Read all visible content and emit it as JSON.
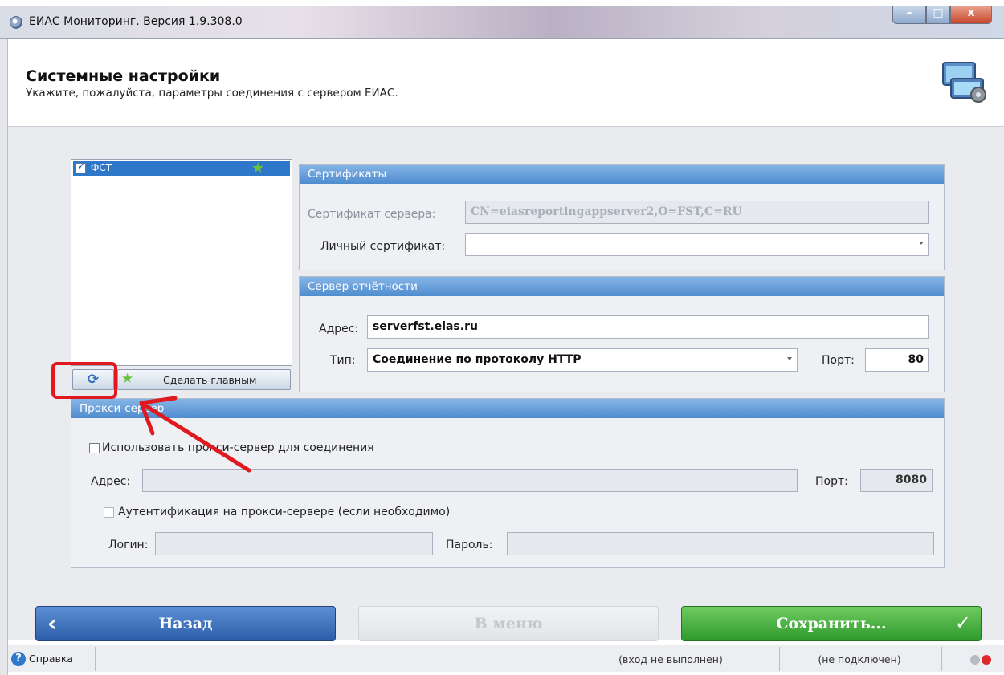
{
  "window": {
    "title": "ЕИАС Мониторинг. Версия 1.9.308.0",
    "minimize_glyph": "–",
    "maximize_glyph": "□",
    "close_glyph": "x"
  },
  "header": {
    "title": "Системные настройки",
    "subtitle": "Укажите, пожалуйста, параметры соединения с сервером ЕИАС."
  },
  "server_list": {
    "items": [
      {
        "label": "ФСТ",
        "checked": true,
        "is_main": true
      }
    ],
    "refresh_icon": "refresh-icon",
    "make_main_label": "Сделать главным"
  },
  "certificates": {
    "heading": "Сертификаты",
    "server_cert_label": "Сертификат сервера:",
    "server_cert_value": "CN=eiasreportingappserver2,O=FST,C=RU",
    "personal_cert_label": "Личный сертификат:",
    "personal_cert_value": ""
  },
  "reporting_server": {
    "heading": "Сервер отчётности",
    "address_label": "Адрес:",
    "address_value": "serverfst.eias.ru",
    "type_label": "Тип:",
    "type_value": "Соединение по протоколу HTTP",
    "port_label": "Порт:",
    "port_value": "80"
  },
  "proxy": {
    "heading": "Прокси-сервер",
    "use_proxy_label": "Использовать прокси-сервер для соединения",
    "use_proxy_checked": false,
    "address_label": "Адрес:",
    "address_value": "",
    "port_label": "Порт:",
    "port_value": "8080",
    "auth_label": "Аутентификация на прокси-сервере (если необходимо)",
    "auth_checked": false,
    "login_label": "Логин:",
    "login_value": "",
    "password_label": "Пароль:",
    "password_value": ""
  },
  "buttons": {
    "back": "Назад",
    "menu": "В меню",
    "save": "Сохранить..."
  },
  "statusbar": {
    "help_label": "Справка",
    "login_status": "(вход не выполнен)",
    "connection_status": "(не подключен)"
  },
  "colors": {
    "accent_blue": "#4f8ccf",
    "save_green": "#2f9a2e",
    "annotation_red": "#e0191e"
  }
}
